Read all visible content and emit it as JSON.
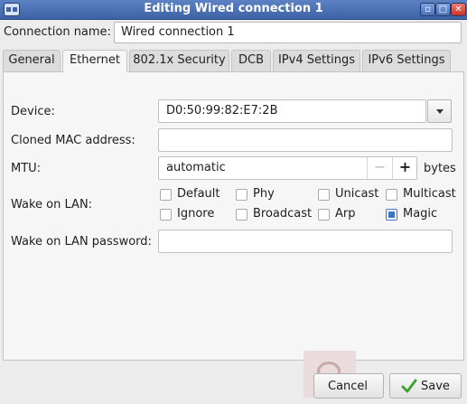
{
  "window": {
    "title": "Editing Wired connection 1"
  },
  "connection": {
    "label": "Connection name:",
    "value": "Wired connection 1"
  },
  "tabs": [
    {
      "label": "General",
      "active": false
    },
    {
      "label": "Ethernet",
      "active": true
    },
    {
      "label": "802.1x Security",
      "active": false
    },
    {
      "label": "DCB",
      "active": false
    },
    {
      "label": "IPv4 Settings",
      "active": false
    },
    {
      "label": "IPv6 Settings",
      "active": false
    }
  ],
  "ethernet": {
    "device_label": "Device:",
    "device_value": "D0:50:99:82:E7:2B",
    "cloned_mac_label": "Cloned MAC address:",
    "cloned_mac_value": "",
    "mtu_label": "MTU:",
    "mtu_value": "automatic",
    "mtu_minus": "−",
    "mtu_plus": "+",
    "mtu_unit": "bytes",
    "wol_label": "Wake on LAN:",
    "wol_options": [
      {
        "label": "Default",
        "checked": false
      },
      {
        "label": "Phy",
        "checked": false
      },
      {
        "label": "Unicast",
        "checked": false
      },
      {
        "label": "Multicast",
        "checked": false
      },
      {
        "label": "Ignore",
        "checked": false
      },
      {
        "label": "Broadcast",
        "checked": false
      },
      {
        "label": "Arp",
        "checked": false
      },
      {
        "label": "Magic",
        "checked": true
      }
    ],
    "wol_password_label": "Wake on LAN password:",
    "wol_password_value": ""
  },
  "buttons": {
    "cancel": "Cancel",
    "save": "Save"
  },
  "colors": {
    "titlebar": "#4a70b3",
    "accent": "#3b76c9",
    "save_check": "#3fa535"
  }
}
